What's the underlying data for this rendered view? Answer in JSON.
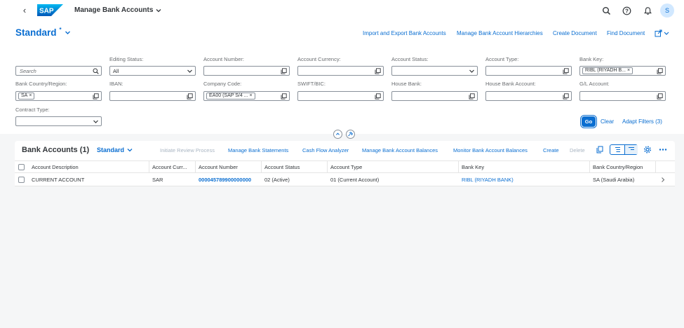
{
  "shell": {
    "back_icon": "back-icon",
    "logo_text": "SAP",
    "app_title": "Manage Bank Accounts",
    "avatar_initial": "S",
    "brand_color": "#0a6ed1"
  },
  "header": {
    "variant_title": "Standard",
    "variant_modified": "*",
    "links": {
      "import_export": "Import and Export Bank Accounts",
      "hierarchies": "Manage Bank Account Hierarchies",
      "create_document": "Create Document",
      "find_document": "Find Document"
    }
  },
  "filters": {
    "search_placeholder": "Search",
    "editing_status": {
      "label": "Editing Status:",
      "value": "All"
    },
    "account_number": {
      "label": "Account Number:"
    },
    "account_currency": {
      "label": "Account Currency:"
    },
    "account_status": {
      "label": "Account Status:"
    },
    "account_type": {
      "label": "Account Type:"
    },
    "bank_key": {
      "label": "Bank Key:",
      "token": "RIBL (RIYADH B..."
    },
    "bank_country": {
      "label": "Bank Country/Region:",
      "token": "SA"
    },
    "iban": {
      "label": "IBAN:"
    },
    "company_code": {
      "label": "Company Code:",
      "token": "EA00 (SAP S/4 ..."
    },
    "swift": {
      "label": "SWIFT/BIC:"
    },
    "house_bank": {
      "label": "House Bank:"
    },
    "house_bank_account": {
      "label": "House Bank Account:"
    },
    "gl_account": {
      "label": "G/L Account:"
    },
    "contract_type": {
      "label": "Contract Type:"
    },
    "go_label": "Go",
    "clear_label": "Clear",
    "adapt_label": "Adapt Filters (3)"
  },
  "table": {
    "title": "Bank Accounts (1)",
    "variant": "Standard",
    "toolbar": {
      "initiate_review": "Initiate Review Process",
      "manage_statements": "Manage Bank Statements",
      "cash_flow": "Cash Flow Analyzer",
      "manage_balances": "Manage Bank Account Balances",
      "monitor_balances": "Monitor Bank Account Balances",
      "create": "Create",
      "delete": "Delete"
    },
    "columns": [
      "Account Description",
      "Account Curr...",
      "Account Number",
      "Account Status",
      "Account Type",
      "Bank Key",
      "Bank Country/Region"
    ],
    "rows": [
      {
        "description": "CURRENT ACCOUNT",
        "currency": "SAR",
        "number": "000045789900000000",
        "status": "02 (Active)",
        "type": "01 (Current Account)",
        "bank_key": "RIBL (RIYADH BANK)",
        "country": "SA (Saudi Arabia)"
      }
    ]
  }
}
